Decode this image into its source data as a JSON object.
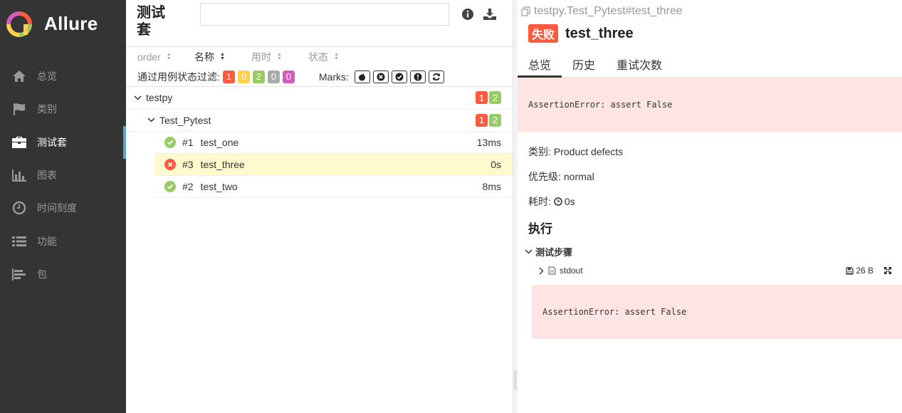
{
  "app": {
    "name": "Allure"
  },
  "sidebar": {
    "items": [
      {
        "label": "总览",
        "icon": "home-icon",
        "active": false
      },
      {
        "label": "类别",
        "icon": "flag-icon",
        "active": false
      },
      {
        "label": "测试套",
        "icon": "briefcase-icon",
        "active": true
      },
      {
        "label": "图表",
        "icon": "bar-chart-icon",
        "active": false
      },
      {
        "label": "时间刻度",
        "icon": "clock-icon",
        "active": false
      },
      {
        "label": "功能",
        "icon": "list-icon",
        "active": false
      },
      {
        "label": "包",
        "icon": "align-left-icon",
        "active": false
      }
    ]
  },
  "suites": {
    "title": "测试套",
    "search": {
      "value": "",
      "placeholder": ""
    },
    "sort": {
      "order": "order",
      "name": "名称",
      "duration": "用时",
      "status": "状态"
    },
    "filter": {
      "label": "通过用例状态过滤:",
      "counts": {
        "failed": "1",
        "broken": "0",
        "passed": "2",
        "skipped": "0",
        "unknown": "0"
      },
      "marks_label": "Marks:"
    },
    "tree": {
      "root": {
        "name": "testpy",
        "failed": "1",
        "passed": "2"
      },
      "child": {
        "name": "Test_Pytest",
        "failed": "1",
        "passed": "2"
      },
      "tests": [
        {
          "num": "#1",
          "name": "test_one",
          "duration": "13ms",
          "status": "passed"
        },
        {
          "num": "#3",
          "name": "test_three",
          "duration": "0s",
          "status": "failed"
        },
        {
          "num": "#2",
          "name": "test_two",
          "duration": "8ms",
          "status": "passed"
        }
      ]
    }
  },
  "detail": {
    "breadcrumb": "testpy.Test_Pytest#test_three",
    "status_label": "失败",
    "title": "test_three",
    "tabs": [
      "总览",
      "历史",
      "重试次数"
    ],
    "error": "AssertionError: assert False",
    "category_label": "类别:",
    "category_value": "Product defects",
    "severity_label": "优先级:",
    "severity_value": "normal",
    "duration_label": "耗时:",
    "duration_value": "0s",
    "execution_title": "执行",
    "steps_title": "测试步骤",
    "attachment": {
      "name": "stdout",
      "size": "26 B",
      "content": "AssertionError: assert False"
    }
  },
  "colors": {
    "failed": "#fd5a3e",
    "broken": "#ffd050",
    "passed": "#97cc64",
    "skipped": "#aaaaaa",
    "unknown": "#d35ebe",
    "sidebar": "#343434"
  }
}
